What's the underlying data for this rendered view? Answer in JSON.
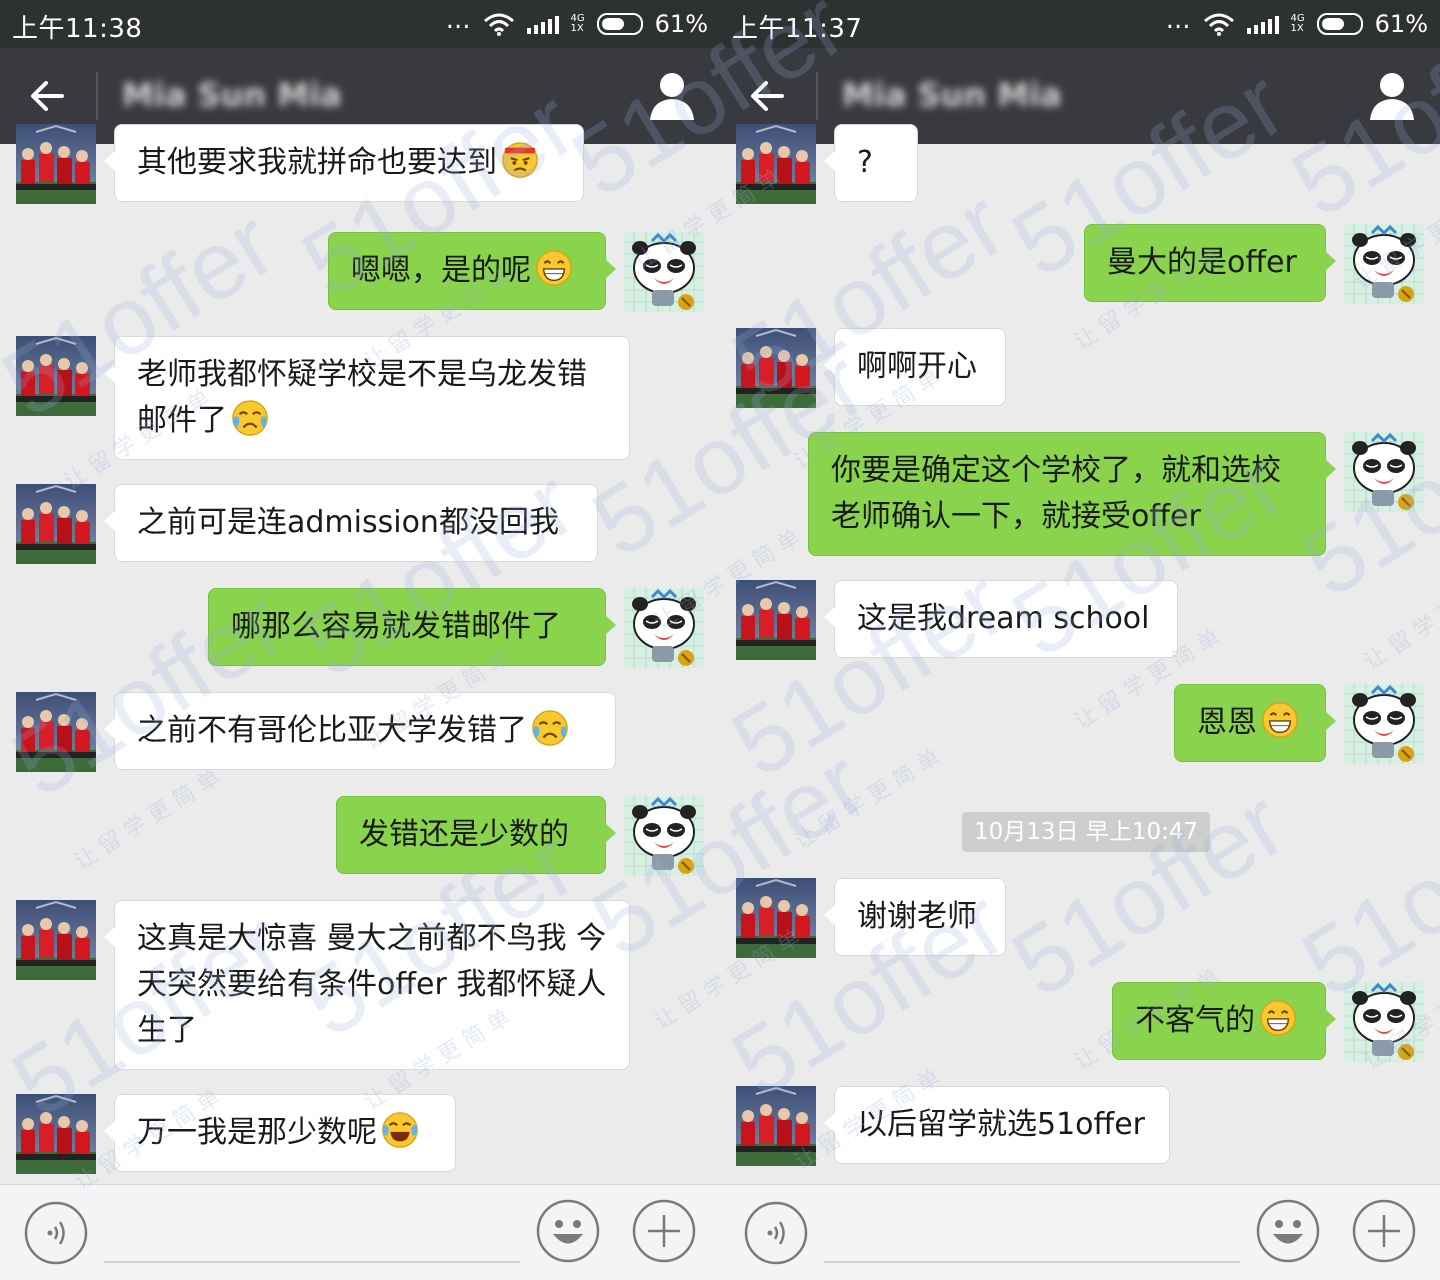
{
  "left_screen": {
    "status": {
      "time": "上午11:38",
      "dots": "...",
      "net_top": "4G",
      "net_bottom": "1X",
      "battery": "61%"
    },
    "title": "Mia Sun Mia",
    "messages": [
      {
        "side": "left",
        "text": "其他要求我就拼命也要达到",
        "emoji": "angry"
      },
      {
        "side": "right",
        "text": "嗯嗯，是的呢",
        "emoji": "grin"
      },
      {
        "side": "left",
        "lines": [
          "老师我都怀疑学校是不是乌龙发错",
          "邮件了"
        ],
        "emoji": "cry"
      },
      {
        "side": "left",
        "text": "之前可是连admission都没回我"
      },
      {
        "side": "right",
        "text": "哪那么容易就发错邮件了"
      },
      {
        "side": "left",
        "text": "之前不有哥伦比亚大学发错了",
        "emoji": "cry"
      },
      {
        "side": "right",
        "text": "发错还是少数的"
      },
      {
        "side": "left",
        "lines": [
          "这真是大惊喜 曼大之前都不鸟我 今",
          "天突然要给有条件offer 我都怀疑人",
          "生了"
        ]
      },
      {
        "side": "left",
        "text": "万一我是那少数呢",
        "emoji": "joy"
      }
    ]
  },
  "right_screen": {
    "status": {
      "time": "上午11:37",
      "dots": "...",
      "net_top": "4G",
      "net_bottom": "1X",
      "battery": "61%"
    },
    "title": "Mia Sun Mia",
    "messages": [
      {
        "side": "left",
        "text": "?"
      },
      {
        "side": "right",
        "text": "曼大的是offer"
      },
      {
        "side": "left",
        "text": "啊啊开心"
      },
      {
        "side": "right",
        "lines": [
          "你要是确定这个学校了，就和选校",
          "老师确认一下，就接受offer"
        ]
      },
      {
        "side": "left",
        "text": "这是我dream school"
      },
      {
        "side": "right",
        "text": "恩恩",
        "emoji": "grin"
      },
      {
        "timestamp": "10月13日 早上10:47"
      },
      {
        "side": "left",
        "text": "谢谢老师"
      },
      {
        "side": "right",
        "text": "不客气的",
        "emoji": "grin"
      },
      {
        "side": "left",
        "text": "以后留学就选51offer"
      }
    ]
  },
  "watermark": {
    "brand": "51offer",
    "tagline": "让 留 学 更 简 单"
  },
  "colors": {
    "status_bar": "#2e3132",
    "app_bar": "#393a3f",
    "chat_bg": "#ebebeb",
    "sent_bubble": "#8ad34c",
    "received_bubble": "#ffffff"
  },
  "icons": {
    "back": "arrow-left-icon",
    "profile": "person-icon",
    "voice": "voice-icon",
    "emoji": "smiley-icon",
    "more": "plus-icon"
  }
}
